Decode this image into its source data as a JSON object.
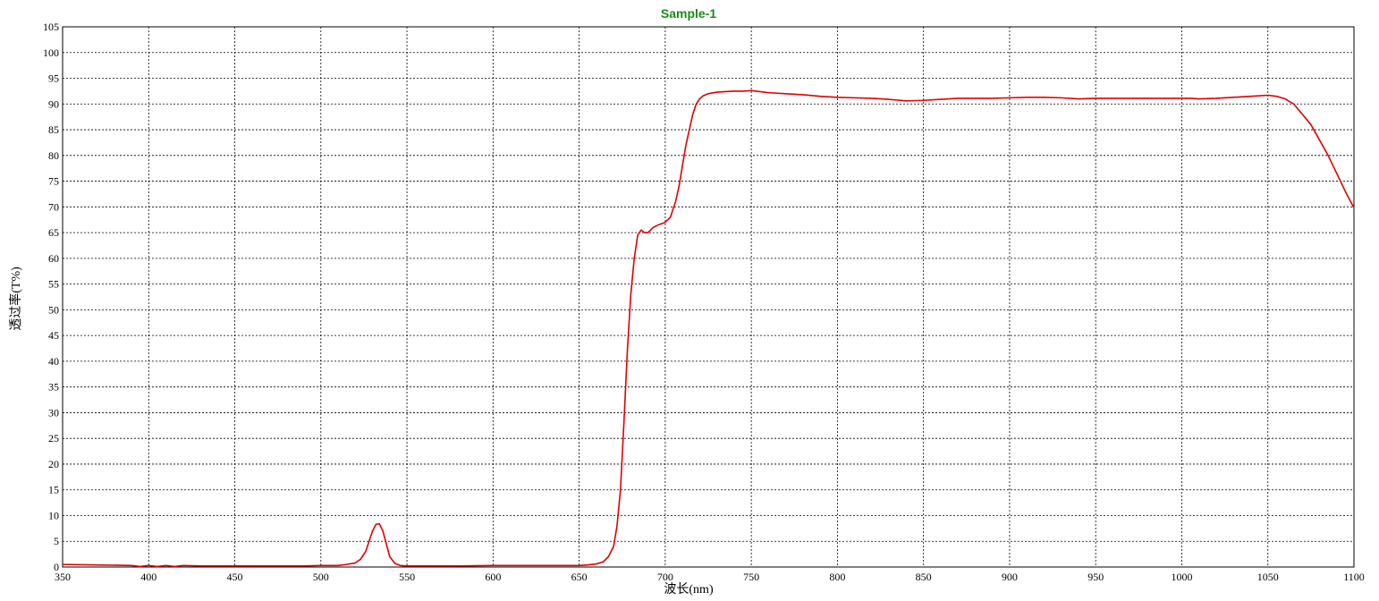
{
  "chart_data": {
    "type": "line",
    "title": "Sample-1",
    "xlabel": "波长(nm)",
    "ylabel": "透过率(T%)",
    "xlim": [
      350,
      1100
    ],
    "ylim": [
      0,
      105
    ],
    "x_ticks": [
      350,
      400,
      450,
      500,
      550,
      600,
      650,
      700,
      750,
      800,
      850,
      900,
      950,
      1000,
      1050,
      1100
    ],
    "y_ticks": [
      0,
      5,
      10,
      15,
      20,
      25,
      30,
      35,
      40,
      45,
      50,
      55,
      60,
      65,
      70,
      75,
      80,
      85,
      90,
      95,
      100,
      105
    ],
    "grid": true,
    "colors": {
      "title": "#1a8a1a",
      "line": "#e00000",
      "grid": "#000000"
    },
    "series": [
      {
        "x": [
          350,
          370,
          390,
          395,
          400,
          405,
          410,
          415,
          420,
          430,
          440,
          450,
          470,
          490,
          500,
          510,
          515,
          520,
          523,
          526,
          528,
          530,
          532,
          534,
          536,
          538,
          540,
          543,
          546,
          550,
          560,
          580,
          600,
          620,
          640,
          650,
          655,
          660,
          664,
          667,
          670,
          672,
          674,
          676,
          678,
          680,
          682,
          684,
          686,
          688,
          690,
          693,
          696,
          700,
          703,
          706,
          708,
          710,
          712,
          714,
          716,
          718,
          720,
          722,
          725,
          730,
          735,
          740,
          745,
          750,
          755,
          760,
          770,
          780,
          790,
          800,
          810,
          820,
          830,
          840,
          850,
          860,
          870,
          880,
          890,
          900,
          910,
          920,
          930,
          940,
          950,
          960,
          970,
          980,
          990,
          1000,
          1005,
          1010,
          1020,
          1030,
          1040,
          1050,
          1055,
          1060,
          1065,
          1070,
          1075,
          1080,
          1085,
          1090,
          1095,
          1100
        ],
        "y": [
          0.5,
          0.4,
          0.3,
          0.1,
          0.3,
          0.1,
          0.3,
          0.1,
          0.3,
          0.2,
          0.2,
          0.2,
          0.2,
          0.2,
          0.3,
          0.3,
          0.5,
          0.8,
          1.5,
          3.0,
          5.0,
          7.0,
          8.3,
          8.4,
          7.0,
          4.5,
          2.0,
          0.7,
          0.3,
          0.2,
          0.2,
          0.2,
          0.3,
          0.3,
          0.3,
          0.3,
          0.4,
          0.6,
          1.0,
          2.0,
          4.0,
          8.0,
          15.0,
          28.0,
          42.0,
          53.0,
          60.0,
          64.5,
          65.5,
          65.0,
          65.0,
          66.0,
          66.5,
          67.0,
          68.0,
          71.0,
          74.0,
          78.0,
          82.0,
          85.0,
          88.0,
          90.0,
          91.0,
          91.6,
          92.0,
          92.3,
          92.4,
          92.5,
          92.5,
          92.6,
          92.4,
          92.2,
          92.0,
          91.8,
          91.5,
          91.3,
          91.2,
          91.1,
          90.9,
          90.6,
          90.7,
          90.9,
          91.1,
          91.1,
          91.1,
          91.2,
          91.3,
          91.3,
          91.2,
          91.0,
          91.1,
          91.1,
          91.1,
          91.1,
          91.1,
          91.1,
          91.1,
          91.0,
          91.1,
          91.3,
          91.5,
          91.7,
          91.5,
          91.0,
          90.0,
          88.0,
          86.0,
          83.0,
          80.0,
          76.5,
          73.0,
          69.8
        ]
      }
    ]
  }
}
